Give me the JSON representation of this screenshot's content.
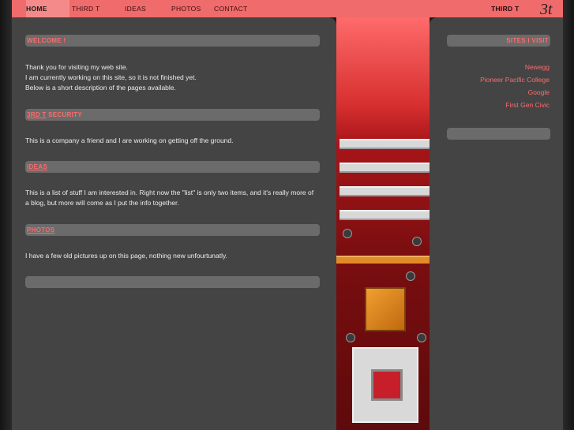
{
  "nav": {
    "items": [
      "HOME",
      "THIRD T",
      "IDEAS",
      "PHOTOS",
      "CONTACT"
    ],
    "brand": "THIRD T",
    "logo_text": "3t"
  },
  "sections": [
    {
      "title_link": "",
      "title_rest": "WELCOME !"
    },
    {
      "title_link": "3RD T",
      "title_rest": " SECURITY"
    },
    {
      "title_link": "IDEAS",
      "title_rest": ""
    },
    {
      "title_link": "PHOTOS",
      "title_rest": ""
    }
  ],
  "welcome": {
    "line1": "Thank you for visiting my web site.",
    "line2": "I am currently working on this site, so it is not finished yet.",
    "line3": "Below is a short description of the pages available."
  },
  "security_text": "This is a company a friend and I are working on getting off the ground.",
  "ideas_text": "This is a list of stuff I am interested in. Right now the \"list\" is only two items, and it's really more of a blog, but more will come as I put the info together.",
  "photos_text": "I have a few old pictures up on this page, nothing new unfourtunatly.",
  "sidebar": {
    "title": "SITES I VISIT",
    "links": [
      "Newegg",
      "Pioneer Pacific College",
      "Google",
      "First Gen Civic"
    ]
  },
  "colors": {
    "accent": "#ff6b6b",
    "topbar": "#f06b6b",
    "panel": "#444444"
  }
}
